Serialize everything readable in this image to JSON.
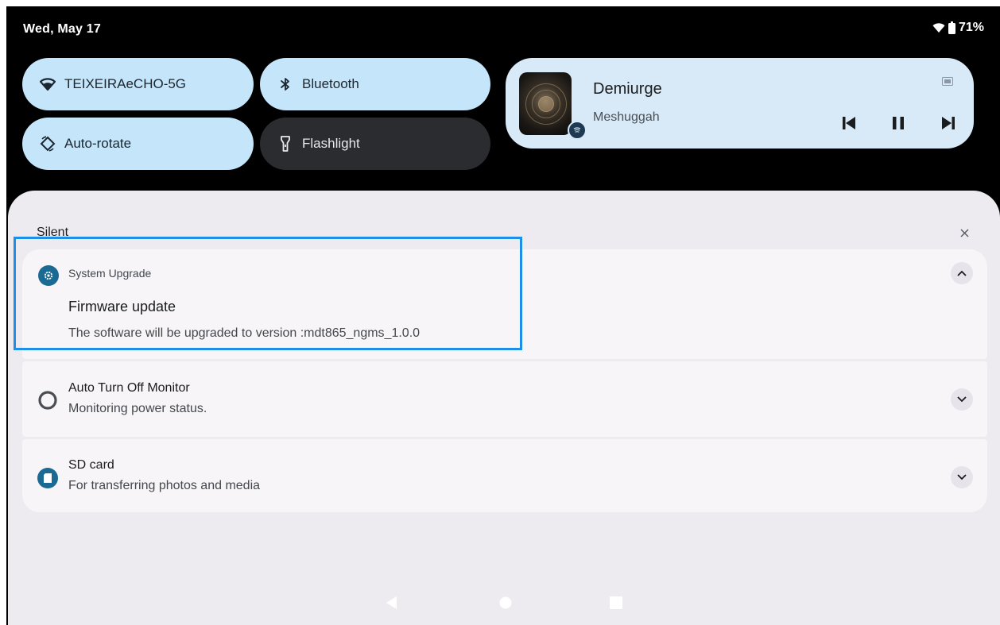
{
  "status_bar": {
    "date": "Wed, May 17",
    "battery": "71%",
    "icons": [
      "wifi-icon",
      "battery-icon"
    ]
  },
  "quick_tiles": [
    {
      "label": "TEIXEIRAeCHO-5G",
      "icon": "wifi-icon",
      "state": "on"
    },
    {
      "label": "Bluetooth",
      "icon": "bluetooth-icon",
      "state": "on"
    },
    {
      "label": "Auto-rotate",
      "icon": "auto-rotate-icon",
      "state": "on"
    },
    {
      "label": "Flashlight",
      "icon": "flashlight-icon",
      "state": "off"
    }
  ],
  "media": {
    "title": "Demiurge",
    "artist": "Meshuggah",
    "app_icon": "spotify-icon",
    "controls": [
      "previous-icon",
      "pause-icon",
      "next-icon"
    ]
  },
  "shade": {
    "section_label": "Silent",
    "clear_icon": "close-icon"
  },
  "notifications": [
    {
      "app_name": "System Upgrade",
      "title": "Firmware update",
      "text": "The software will be upgraded to version :mdt865_ngms_1.0.0",
      "icon": "gear-icon",
      "expanded": true
    },
    {
      "title": "Auto Turn Off Monitor",
      "text": "Monitoring power status.",
      "icon": "circle-icon",
      "expanded": false
    },
    {
      "title": "SD card",
      "text": "For transferring photos and media",
      "icon": "sd-card-icon",
      "expanded": false
    }
  ],
  "colors": {
    "tile_on": "#c4e5fa",
    "tile_off": "#2b2c2f",
    "media_bg": "#d8eaf8",
    "shade_bg": "#eeebf0",
    "accent_icon": "#1b6a93",
    "highlight": "#1e8fe6"
  }
}
